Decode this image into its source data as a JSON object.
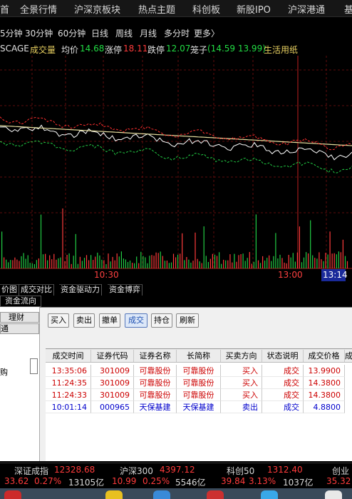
{
  "topnav": [
    "首",
    "全景行情",
    "沪深京板块",
    "热点主题",
    "科创板",
    "新股IPO",
    "沪深港通",
    "基"
  ],
  "periods": [
    "5分钟",
    "30分钟",
    "60分钟",
    "日线",
    "周线",
    "月线",
    "多分时",
    "更多〉"
  ],
  "info": {
    "code": "SCAGE",
    "vol_label": "成交量",
    "avg_label": "均价",
    "avg_value": "14.68",
    "limit_up_label": "涨停",
    "limit_up_value": "18.11",
    "limit_down_label": "跌停",
    "limit_down_value": "12.07",
    "cage_label": "笼子",
    "cage_value": "(14.59 13.99)",
    "sector": "生活用纸"
  },
  "time_axis": [
    "10:30",
    "13:00",
    "13:14"
  ],
  "tabs": [
    "价图",
    "成交对比",
    "资金驱动力",
    "资金博弈"
  ],
  "tab2": "资金流向",
  "left_panel": {
    "btn1": "理财",
    "btn2": "通",
    "text": "购"
  },
  "toolbar": [
    "买入",
    "卖出",
    "撤单",
    "成交",
    "持仓",
    "刷新"
  ],
  "grid": {
    "headers": [
      "成交时间",
      "证券代码",
      "证券名称",
      "长简称",
      "买卖方向",
      "状态说明",
      "成交价格",
      "成"
    ],
    "rows": [
      {
        "time": "13:35:06",
        "code": "301009",
        "name": "可靠股份",
        "short": "可靠股份",
        "dir": "买入",
        "status": "成交",
        "price": "13.9900"
      },
      {
        "time": "11:24:35",
        "code": "301009",
        "name": "可靠股份",
        "short": "可靠股份",
        "dir": "买入",
        "status": "成交",
        "price": "14.3800"
      },
      {
        "time": "11:24:33",
        "code": "301009",
        "name": "可靠股份",
        "short": "可靠股份",
        "dir": "买入",
        "status": "成交",
        "price": "14.3800"
      },
      {
        "time": "10:01:14",
        "code": "000965",
        "name": "天保基建",
        "short": "天保基建",
        "dir": "卖出",
        "status": "成交",
        "price": "4.8800"
      }
    ]
  },
  "status": {
    "sz_label": "深证成指",
    "sz_value": "12328.68",
    "sz_chg": "33.62",
    "sz_pct": "0.27%",
    "sz_amt": "13105亿",
    "hs_label": "沪深300",
    "hs_value": "4397.12",
    "hs_chg": "10.99",
    "hs_pct": "0.25%",
    "hs_amt": "5546亿",
    "kc_label": "科创50",
    "kc_value": "1312.40",
    "kc_chg": "39.84",
    "kc_pct": "3.13%",
    "kc_amt": "1037亿",
    "cy_label": "创业",
    "cy_chg": "35.32"
  },
  "colors": {
    "up": "#ff3b3b",
    "down": "#22cc44",
    "avg": "#e8e0a0",
    "grid_red": "#8a1010",
    "blue_text": "#0000cc",
    "red_text": "#cc0000"
  }
}
